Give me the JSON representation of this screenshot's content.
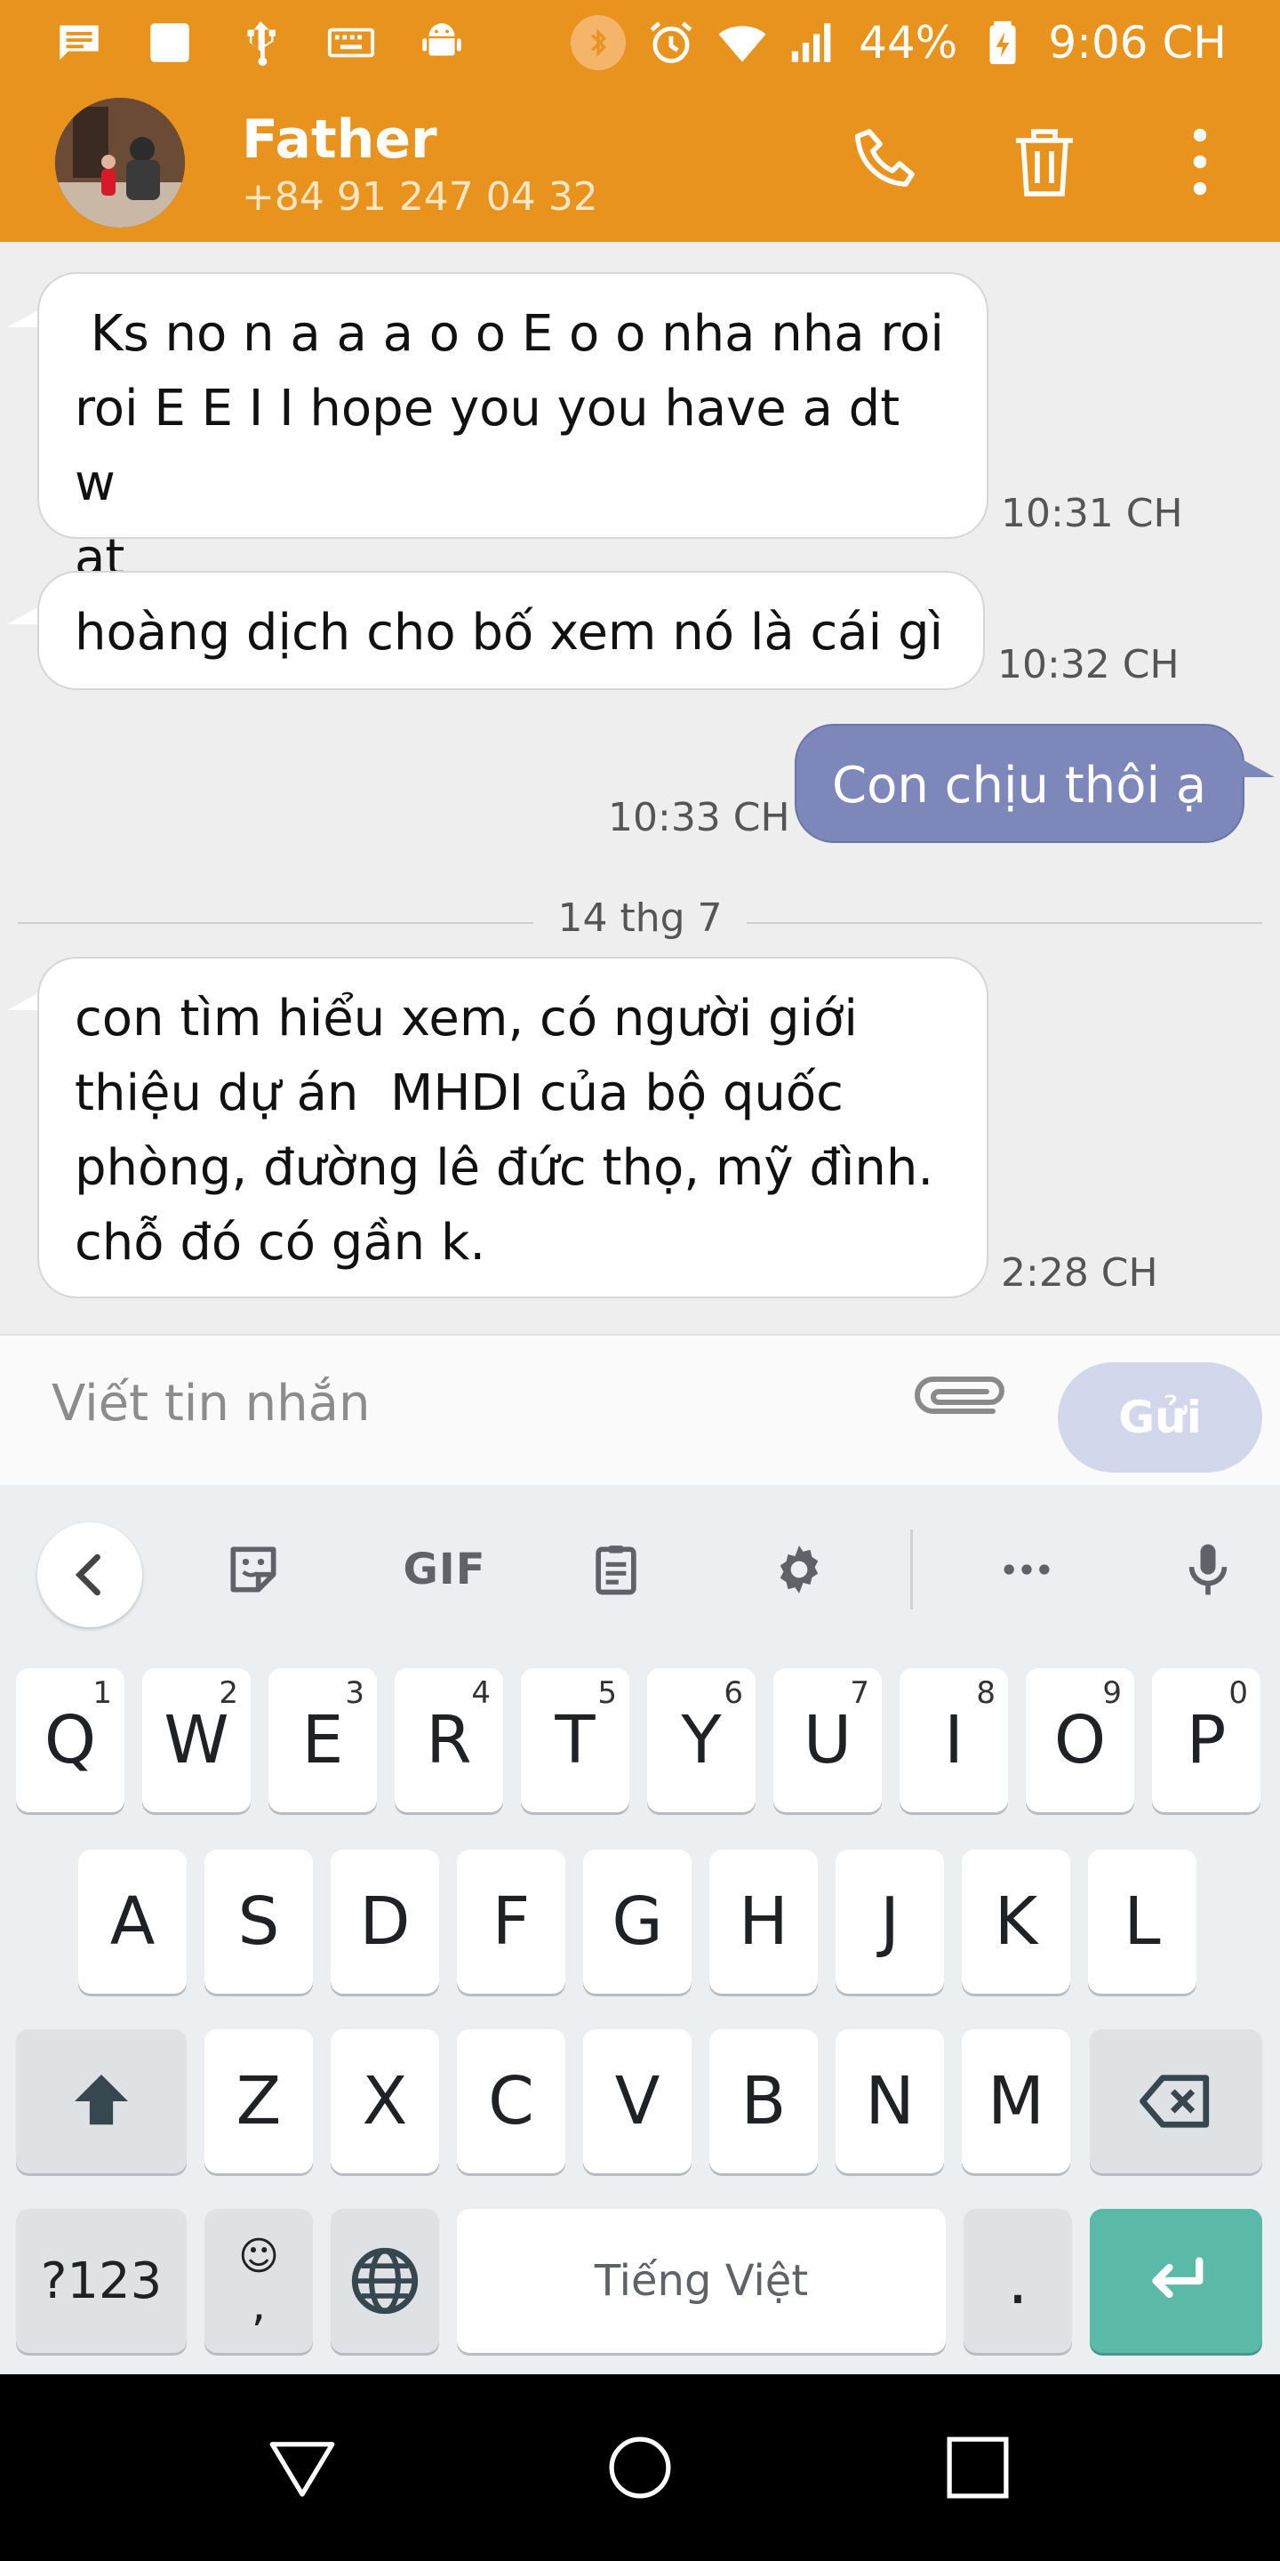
{
  "status_bar": {
    "left_icons": [
      "message-icon",
      "square-icon",
      "usb-icon",
      "keyboard-icon",
      "android-icon"
    ],
    "right_icons": [
      "bluetooth-icon",
      "alarm-icon",
      "wifi-icon",
      "signal-icon",
      "battery-icon"
    ],
    "battery": "44%",
    "time": "9:06 CH"
  },
  "header": {
    "name": "Father",
    "phone": "+84 91 247 04 32",
    "actions": [
      "phone-icon",
      "trash-icon",
      "more-vert-icon"
    ]
  },
  "colors": {
    "accent": "#e8931e",
    "outgoing_bubble": "#7d87b9",
    "send_button": "#d3d7ec",
    "enter_key": "#5bbaa7"
  },
  "messages": [
    {
      "direction": "in",
      "lines": [
        " Ks no n a a a o o E o o nha nha roi",
        "roi E E I I hope you you have a dt w",
        "at"
      ],
      "time": "10:31 CH"
    },
    {
      "direction": "in",
      "lines": [
        "hoàng dịch cho bố xem nó là cái gì"
      ],
      "time": "10:32 CH"
    },
    {
      "direction": "out",
      "lines": [
        "Con chịu thôi ạ"
      ],
      "time": "10:33 CH"
    },
    {
      "direction": "in",
      "lines": [
        "con tìm hiểu xem, có người giới",
        "thiệu dự án  MHDI của bộ quốc",
        "phòng, đường lê đức thọ, mỹ đình.",
        "chỗ đó có gần k."
      ],
      "time": "2:28 CH"
    }
  ],
  "date_separator": "14 thg 7",
  "composer": {
    "placeholder": "Viết tin nhắn",
    "send_label": "Gửi",
    "attach_icon": "paperclip-icon"
  },
  "keyboard": {
    "toolbar": {
      "gif_label": "GIF",
      "icons": [
        "back-chevron-icon",
        "sticker-icon",
        "gif-icon",
        "clipboard-icon",
        "settings-gear-icon",
        "more-horiz-icon",
        "microphone-icon"
      ]
    },
    "row1": [
      {
        "k": "Q",
        "h": "1"
      },
      {
        "k": "W",
        "h": "2"
      },
      {
        "k": "E",
        "h": "3"
      },
      {
        "k": "R",
        "h": "4"
      },
      {
        "k": "T",
        "h": "5"
      },
      {
        "k": "Y",
        "h": "6"
      },
      {
        "k": "U",
        "h": "7"
      },
      {
        "k": "I",
        "h": "8"
      },
      {
        "k": "O",
        "h": "9"
      },
      {
        "k": "P",
        "h": "0"
      }
    ],
    "row2": [
      "A",
      "S",
      "D",
      "F",
      "G",
      "H",
      "J",
      "K",
      "L"
    ],
    "row3": [
      "Z",
      "X",
      "C",
      "V",
      "B",
      "N",
      "M"
    ],
    "symbols_label": "?123",
    "emoji_comma_label": ",",
    "space_label": "Tiếng Việt",
    "period_label": "."
  },
  "nav_bar": [
    "back-triangle-icon",
    "home-circle-icon",
    "recents-square-icon"
  ]
}
